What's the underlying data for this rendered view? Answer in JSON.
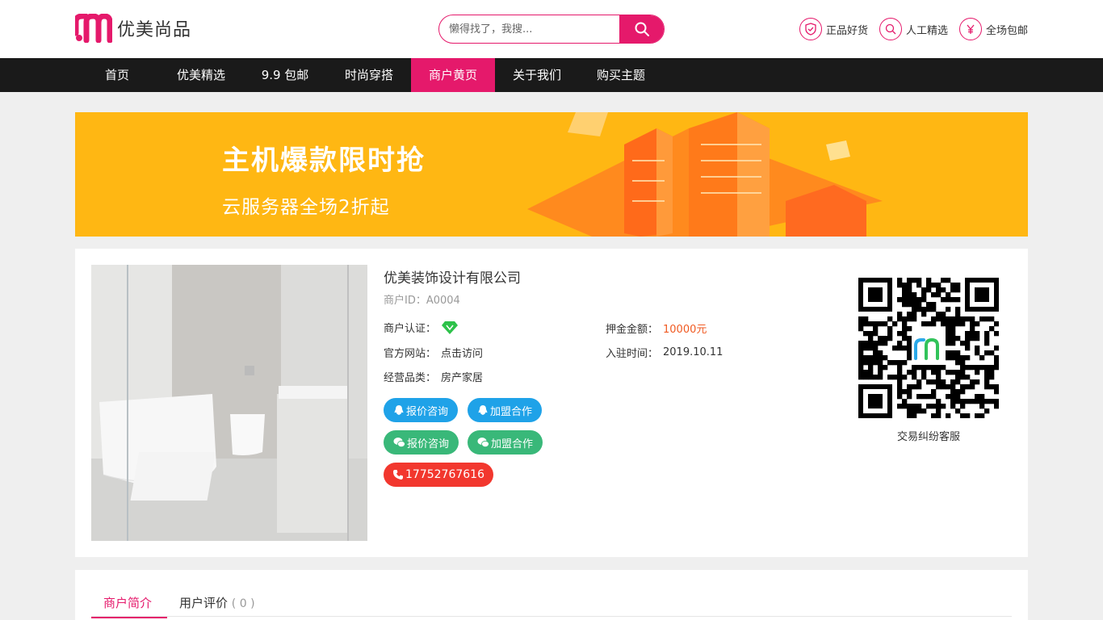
{
  "header": {
    "logo_text": "优美尚品",
    "search_placeholder": "懒得找了，我搜...",
    "badges": [
      {
        "label": "正品好货",
        "icon": "shield-check-icon"
      },
      {
        "label": "人工精选",
        "icon": "magnifier-icon"
      },
      {
        "label": "全场包邮",
        "icon": "yen-icon"
      }
    ]
  },
  "nav": {
    "items": [
      "首页",
      "优美精选",
      "9.9 包邮",
      "时尚穿搭",
      "商户黄页",
      "关于我们",
      "购买主题"
    ],
    "active_index": 4
  },
  "banner": {
    "title": "主机爆款限时抢",
    "subtitle": "云服务器全场2折起"
  },
  "merchant": {
    "name": "优美装饰设计有限公司",
    "id_label": "商户ID：A0004",
    "cert_label": "商户认证：",
    "deposit_label": "押金金额：",
    "deposit_value": "10000元",
    "website_label": "官方网站：",
    "website_value": "点击访问",
    "join_label": "入驻时间：",
    "join_value": "2019.10.11",
    "category_label": "经营品类：",
    "category_value": "房产家居",
    "qq_quote": "报价咨询",
    "qq_join": "加盟合作",
    "wx_quote": "报价咨询",
    "wx_join": "加盟合作",
    "phone": "17752767616",
    "qr_caption": "交易纠纷客服"
  },
  "tabs": {
    "intro": "商户简介",
    "reviews": "用户评价",
    "review_count": "( 0 )"
  },
  "colors": {
    "accent": "#e5196b",
    "nav_bg": "#1a1a1a",
    "banner_bg": "#ffb713",
    "qq_blue": "#1fa2e8",
    "wechat_green": "#39b879",
    "phone_red": "#f2372e",
    "deposit_orange": "#f05a22"
  }
}
